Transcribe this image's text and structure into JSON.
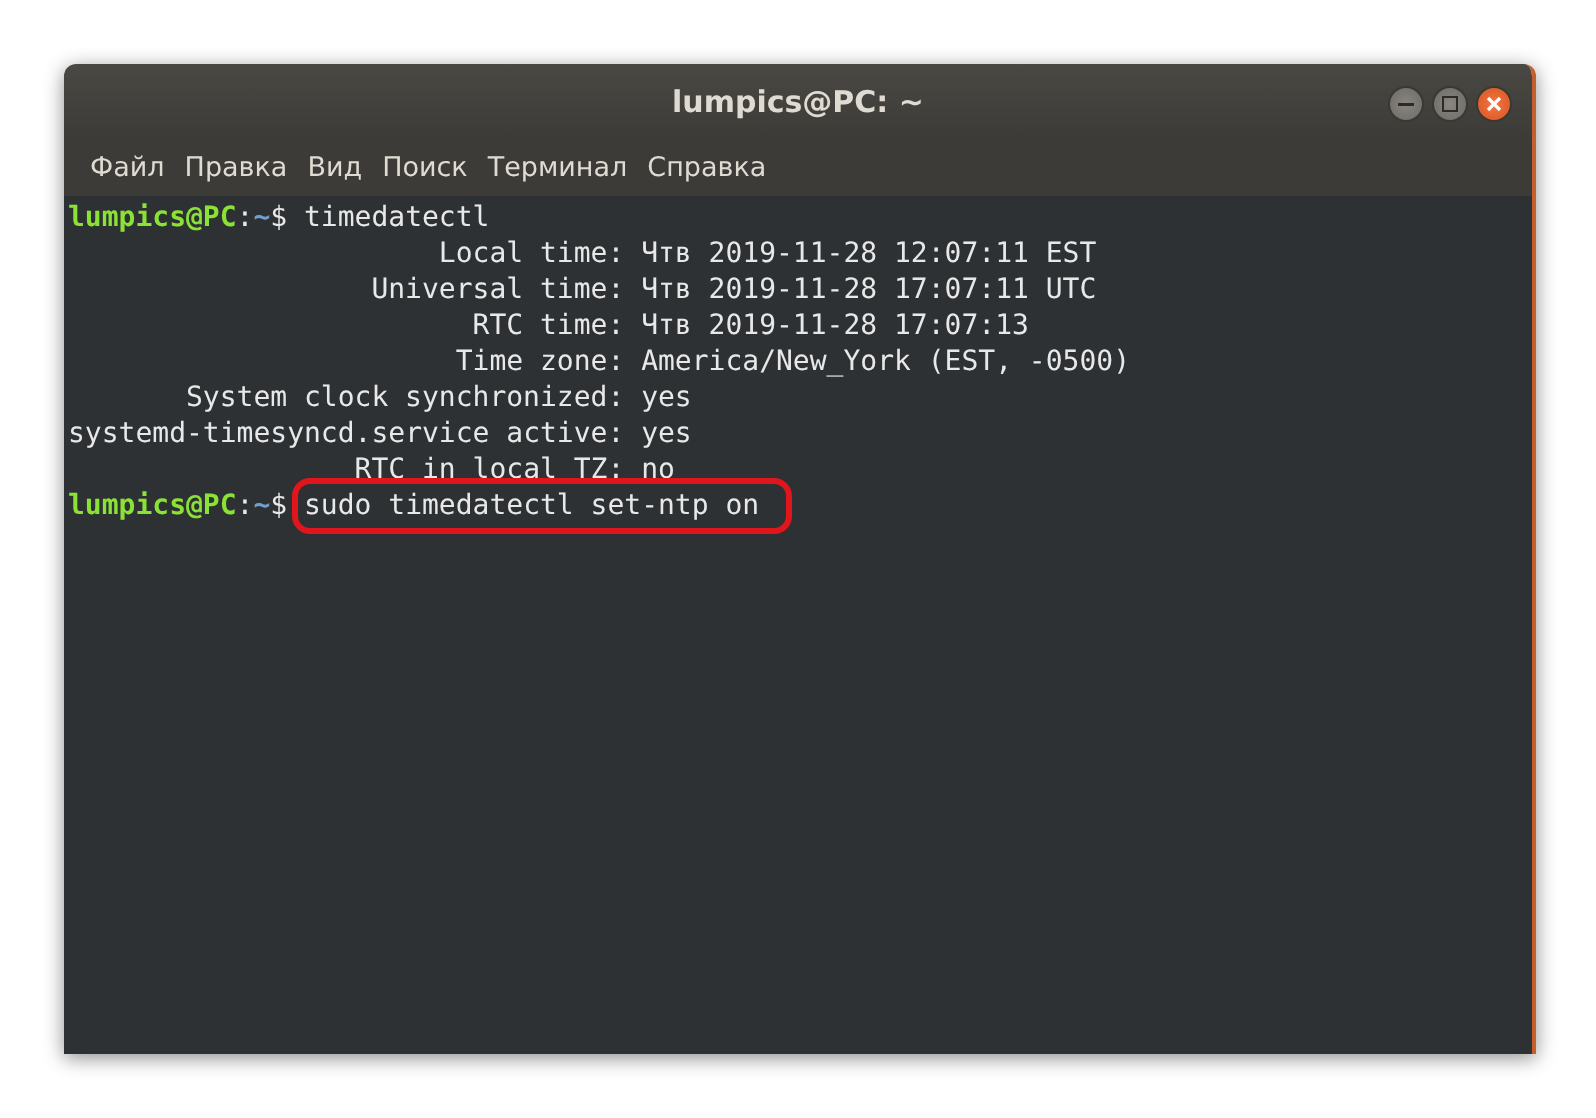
{
  "window": {
    "title": "lumpics@PC: ~"
  },
  "menu": [
    "Файл",
    "Правка",
    "Вид",
    "Поиск",
    "Терминал",
    "Справка"
  ],
  "terminal": {
    "lines": [
      {
        "kind": "prompt",
        "user": "lumpics@PC",
        "separator": ":",
        "path": "~",
        "symbol": "$",
        "command": "timedatectl",
        "highlighted": false
      },
      {
        "kind": "output",
        "label": "Local time:",
        "value": "Чтв 2019-11-28 12:07:11 EST"
      },
      {
        "kind": "output",
        "label": "Universal time:",
        "value": "Чтв 2019-11-28 17:07:11 UTC"
      },
      {
        "kind": "output",
        "label": "RTC time:",
        "value": "Чтв 2019-11-28 17:07:13"
      },
      {
        "kind": "output",
        "label": "Time zone:",
        "value": "America/New_York (EST, -0500)"
      },
      {
        "kind": "output",
        "label": "System clock synchronized:",
        "value": "yes"
      },
      {
        "kind": "output",
        "label": "systemd-timesyncd.service active:",
        "value": "yes"
      },
      {
        "kind": "output",
        "label": "RTC in local TZ:",
        "value": "no"
      },
      {
        "kind": "prompt",
        "user": "lumpics@PC",
        "separator": ":",
        "path": "~",
        "symbol": "$",
        "command": "sudo timedatectl set-ntp on",
        "highlighted": true
      }
    ]
  }
}
